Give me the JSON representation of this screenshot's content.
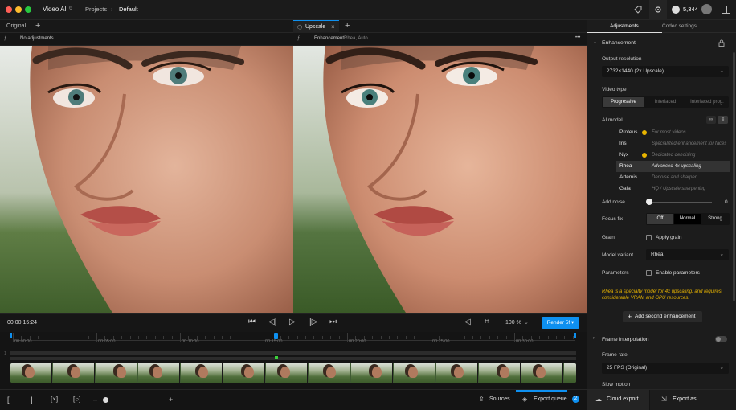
{
  "titlebar": {
    "app_name": "Video AI",
    "version_badge": "6",
    "breadcrumb_projects": "Projects",
    "breadcrumb_sep": "›",
    "breadcrumb_current": "Default",
    "credits": "5,344"
  },
  "left_pane": {
    "tab_label": "Original",
    "add_tab": "+",
    "toolbar_text": "No adjustments"
  },
  "right_pane": {
    "tab_label": "Upscale",
    "close": "×",
    "add_tab": "+",
    "toolbar_label": "Enhancement",
    "toolbar_detail": "Rhea, Auto",
    "more": "•••"
  },
  "controls": {
    "timecode": "00:00:15:24",
    "zoom": "100 %",
    "render_label": "Render 5f"
  },
  "timeline": {
    "labels": [
      "00:00:00",
      "00:05:00",
      "00:10:00",
      "00:15:00",
      "00:20:00",
      "00:25:00",
      "00:30:00"
    ]
  },
  "bottombar": {
    "sources": "Sources",
    "export_queue": "Export queue",
    "queue_count": "2",
    "cloud_export": "Cloud export",
    "export_as": "Export as..."
  },
  "panel": {
    "tabs": [
      "Adjustments",
      "Codec settings"
    ],
    "enhancement_header": "Enhancement",
    "output_resolution_label": "Output resolution",
    "output_resolution_value": "2732×1440 (2x Upscale)",
    "video_type_label": "Video type",
    "video_type_options": [
      "Progressive",
      "Interlaced",
      "Interlaced prog."
    ],
    "ai_model_label": "AI model",
    "models": [
      {
        "name": "Proteus",
        "desc": "For most videos",
        "dot": true
      },
      {
        "name": "Iris",
        "desc": "Specialized enhancement for faces",
        "dot": false
      },
      {
        "name": "Nyx",
        "desc": "Dedicated denoising",
        "dot": true
      },
      {
        "name": "Rhea",
        "desc": "Advanced 4x upscaling",
        "dot": false
      },
      {
        "name": "Artemis",
        "desc": "Denoise and sharpen",
        "dot": false
      },
      {
        "name": "Gaia",
        "desc": "HQ / Upscale sharpening",
        "dot": false
      }
    ],
    "add_noise_label": "Add noise",
    "add_noise_value": "0",
    "focus_fix_label": "Focus fix",
    "focus_fix_options": [
      "Off",
      "Normal",
      "Strong"
    ],
    "grain_label": "Grain",
    "apply_grain": "Apply grain",
    "model_variant_label": "Model variant",
    "model_variant_value": "Rhea",
    "parameters_label": "Parameters",
    "enable_parameters": "Enable parameters",
    "note": "Rhea is a specialty model for 4x upscaling, and requires considerable VRAM and GPU resources.",
    "add_second": "Add second enhancement",
    "frame_interp": "Frame interpolation",
    "frame_rate_label": "Frame rate",
    "frame_rate_value": "25 FPS (Original)",
    "slow_motion": "Slow motion"
  }
}
